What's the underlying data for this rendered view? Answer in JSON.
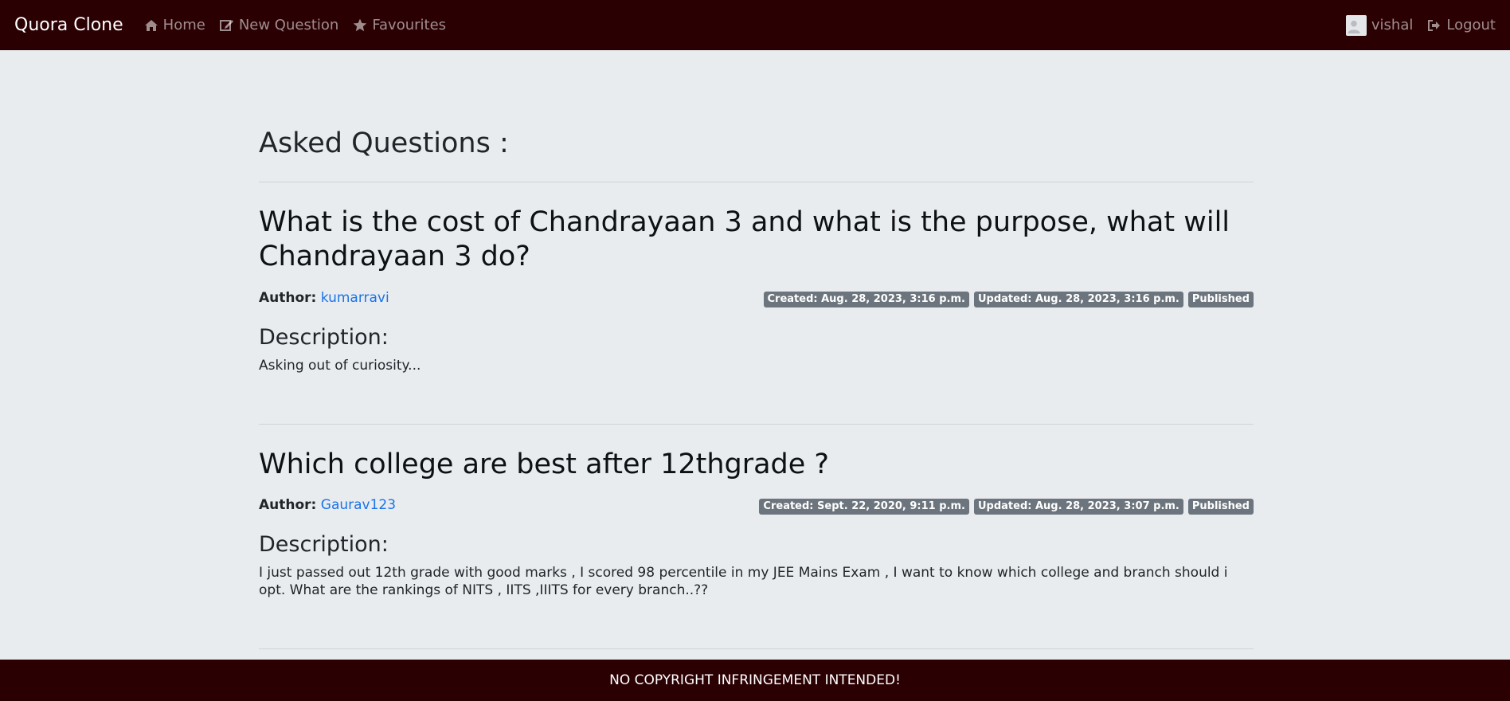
{
  "navbar": {
    "brand": "Quora Clone",
    "links": [
      {
        "label": "Home",
        "icon": "home-icon"
      },
      {
        "label": "New Question",
        "icon": "edit-icon"
      },
      {
        "label": "Favourites",
        "icon": "star-icon"
      }
    ],
    "user": {
      "name": "vishal",
      "icon": "user-avatar"
    },
    "logout": {
      "label": "Logout",
      "icon": "logout-icon"
    }
  },
  "main": {
    "heading": "Asked Questions :",
    "questions": [
      {
        "title": "What is the cost of Chandrayaan 3 and what is the purpose, what will Chandrayaan 3 do?",
        "author_label": "Author:",
        "author": "kumarravi",
        "created": "Created: Aug. 28, 2023, 3:16 p.m.",
        "updated": "Updated: Aug. 28, 2023, 3:16 p.m.",
        "status": "Published",
        "description_heading": "Description:",
        "description": "Asking out of curiosity..."
      },
      {
        "title": "Which college are best after 12thgrade ?",
        "author_label": "Author:",
        "author": "Gaurav123",
        "created": "Created: Sept. 22, 2020, 9:11 p.m.",
        "updated": "Updated: Aug. 28, 2023, 3:07 p.m.",
        "status": "Published",
        "description_heading": "Description:",
        "description": "I just passed out 12th grade with good marks , I scored 98 percentile in my JEE Mains Exam , I want to know which college and branch should i opt. What are the rankings of NITS , IITS ,IIITS for every branch..??"
      }
    ]
  },
  "footer": {
    "text": "NO COPYRIGHT INFRINGEMENT INTENDED!"
  },
  "colors": {
    "navbar_bg": "#2a0003",
    "page_bg": "#e9ecef",
    "link": "#1a73e8",
    "badge_bg": "#6c757d"
  }
}
